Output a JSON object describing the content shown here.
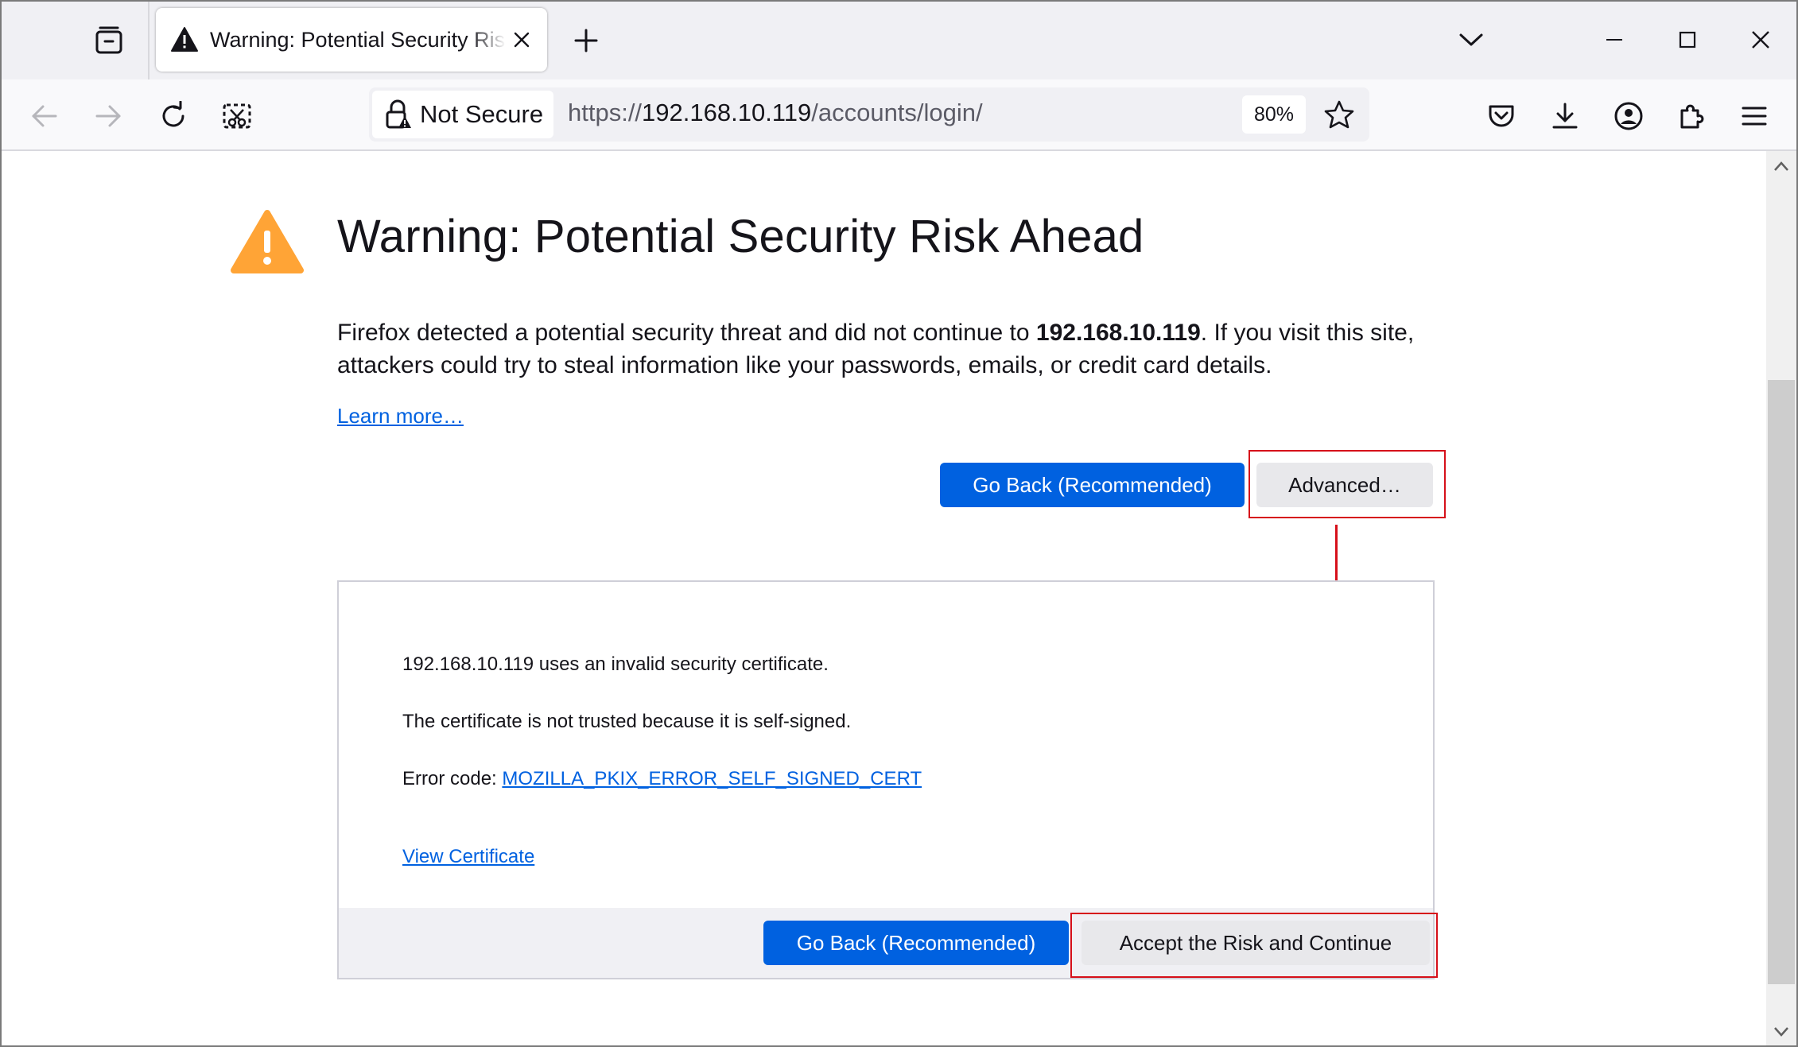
{
  "browser": {
    "tab": {
      "title": "Warning: Potential Security Risk Ahead"
    },
    "new_tab_symbol": "+",
    "nav": {
      "not_secure_label": "Not Secure",
      "url_prefix": "https://",
      "url_host": "192.168.10.119",
      "url_path": "/accounts/login/",
      "zoom": "80%"
    },
    "icons": {
      "tab_list": "tab-list-icon",
      "tab_warning": "warning-icon",
      "tab_close": "close-icon",
      "new_tab": "plus-icon",
      "list_all_tabs": "chevron-down-icon",
      "minimize": "minimize-icon",
      "maximize": "maximize-icon",
      "close_window": "close-icon",
      "back": "back-arrow-icon",
      "forward": "forward-arrow-icon",
      "reload": "reload-icon",
      "screenshot": "screenshot-icon",
      "lock": "lock-warning-icon",
      "bookmark": "star-icon",
      "pocket": "pocket-icon",
      "downloads": "download-icon",
      "account": "account-icon",
      "extensions": "extensions-icon",
      "menu": "hamburger-menu-icon"
    }
  },
  "page": {
    "title": "Warning: Potential Security Risk Ahead",
    "description": {
      "before": "Firefox detected a potential security threat and did not continue to ",
      "host": "192.168.10.119",
      "after": ". If you visit this site, attackers could try to steal information like your passwords, emails, or credit card details."
    },
    "learn_more": "Learn more…",
    "go_back_label": "Go Back (Recommended)",
    "advanced_label": "Advanced…",
    "advanced": {
      "line1": "192.168.10.119 uses an invalid security certificate.",
      "line2": "The certificate is not trusted because it is self-signed.",
      "error_prefix": "Error code: ",
      "error_code": "MOZILLA_PKIX_ERROR_SELF_SIGNED_CERT",
      "view_certificate": "View Certificate",
      "go_back_label": "Go Back (Recommended)",
      "accept_label": "Accept the Risk and Continue"
    }
  },
  "colors": {
    "primary_button": "#0061e0",
    "warning_icon": "#ffa436",
    "annotation": "#d6101a",
    "link": "#0061e0"
  }
}
